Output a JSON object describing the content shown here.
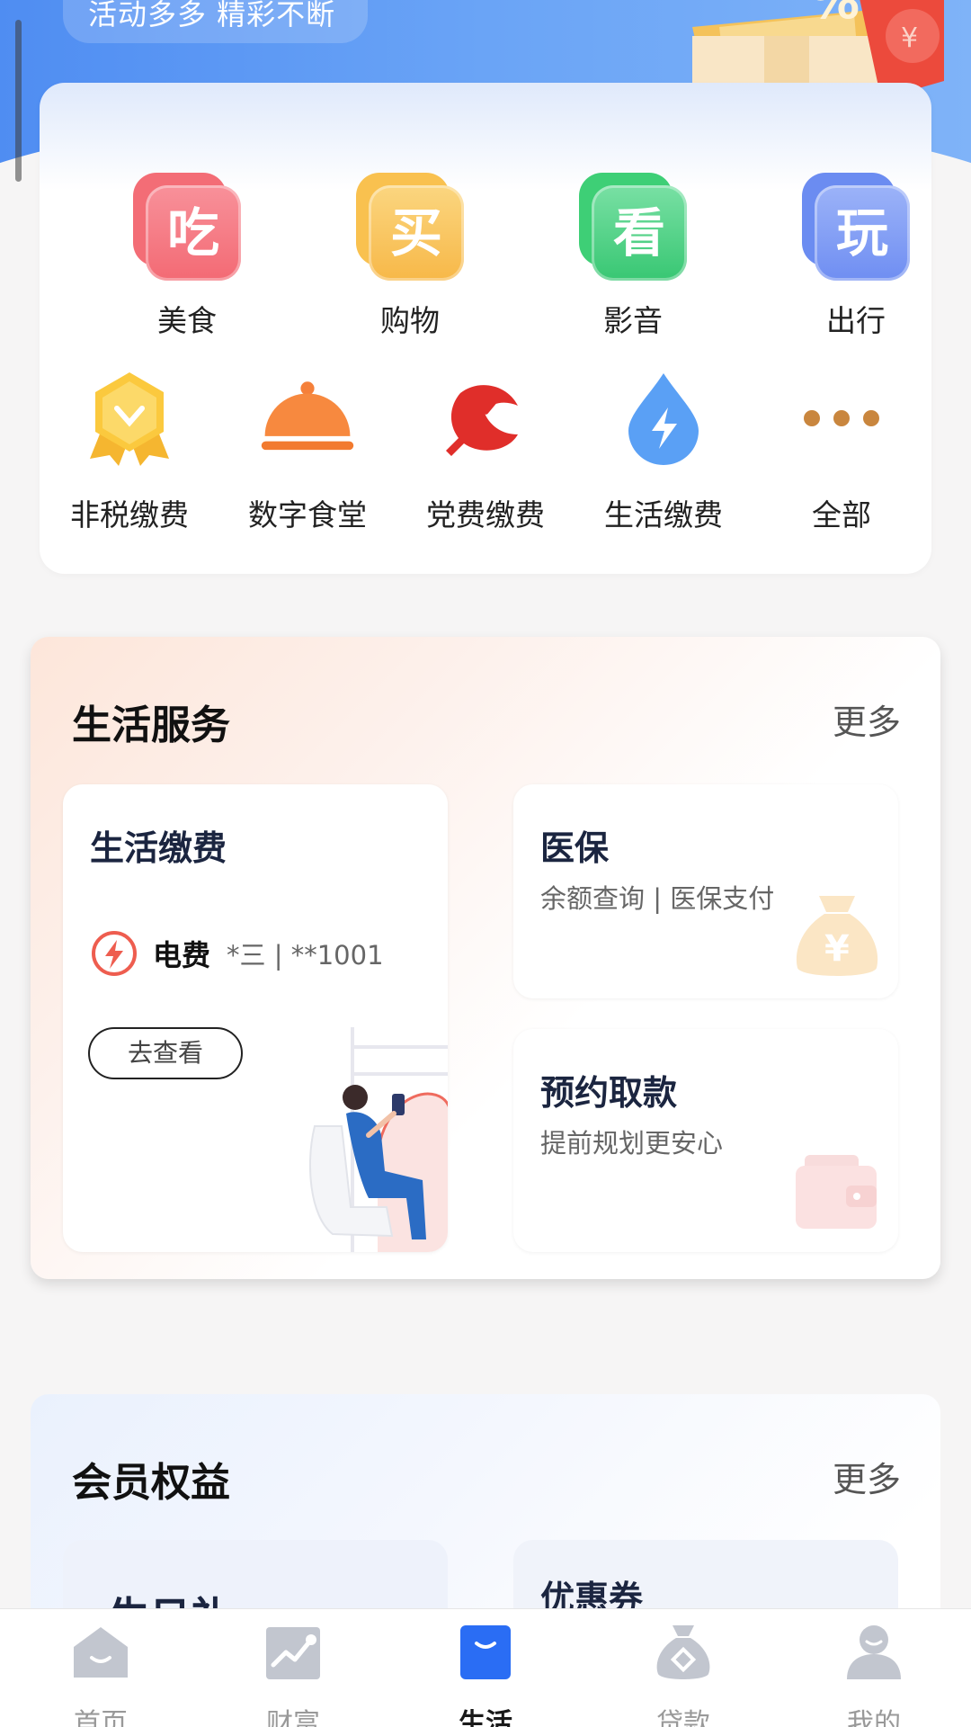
{
  "banner": {
    "slogan": "活动多多 精彩不断"
  },
  "categories_top": [
    {
      "label": "美食",
      "char": "吃",
      "icon": "food-icon",
      "color": "#f06a72"
    },
    {
      "label": "购物",
      "char": "买",
      "icon": "shopping-icon",
      "color": "#f7b84a"
    },
    {
      "label": "影音",
      "char": "看",
      "icon": "video-icon",
      "color": "#3ccf78"
    },
    {
      "label": "出行",
      "char": "玩",
      "icon": "travel-icon",
      "color": "#6f8ef2"
    }
  ],
  "categories_bottom": [
    {
      "label": "非税缴费",
      "icon": "medal-icon"
    },
    {
      "label": "数字食堂",
      "icon": "cloche-icon"
    },
    {
      "label": "党费缴费",
      "icon": "party-emblem-icon"
    },
    {
      "label": "生活缴费",
      "icon": "water-drop-bolt-icon"
    },
    {
      "label": "全部",
      "icon": "more-dots-icon"
    }
  ],
  "life_services": {
    "title": "生活服务",
    "more": "更多",
    "payment": {
      "title": "生活缴费",
      "item_name": "电费",
      "item_account": "*三 | **1001",
      "button": "去查看"
    },
    "medical": {
      "title": "医保",
      "subtitle": "余额查询 | 医保支付"
    },
    "withdraw": {
      "title": "预约取款",
      "subtitle": "提前规划更安心"
    }
  },
  "member": {
    "title": "会员权益",
    "more": "更多",
    "left_partial": "生日礼",
    "coupon": "优惠券"
  },
  "nav": [
    {
      "label": "首页",
      "icon": "home-icon",
      "active": false
    },
    {
      "label": "财富",
      "icon": "wealth-chart-icon",
      "active": false
    },
    {
      "label": "生活",
      "icon": "shopping-bag-icon",
      "active": true
    },
    {
      "label": "贷款",
      "icon": "money-bag-icon",
      "active": false
    },
    {
      "label": "我的",
      "icon": "user-icon",
      "active": false
    }
  ],
  "colors": {
    "accent": "#2a6df4",
    "brand_blue": "#4f8df2"
  }
}
